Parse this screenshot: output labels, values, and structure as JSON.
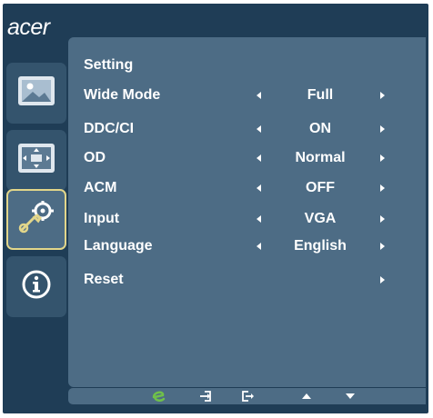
{
  "brand": {
    "logo_text": "acer"
  },
  "sidebar": {
    "items": [
      {
        "name": "picture",
        "icon": "picture-icon",
        "active": false
      },
      {
        "name": "osd-position",
        "icon": "osd-position-icon",
        "active": false
      },
      {
        "name": "setting",
        "icon": "wrench-gear-icon",
        "active": true
      },
      {
        "name": "information",
        "icon": "info-icon",
        "active": false
      }
    ]
  },
  "menu": {
    "title": "Setting",
    "rows": [
      {
        "label": "Wide Mode",
        "value": "Full",
        "arrows": true
      },
      {
        "label": "DDC/CI",
        "value": "ON",
        "arrows": true
      },
      {
        "label": "OD",
        "value": "Normal",
        "arrows": true
      },
      {
        "label": "ACM",
        "value": "OFF",
        "arrows": true
      },
      {
        "label": "Input",
        "value": "VGA",
        "arrows": true
      },
      {
        "label": "Language",
        "value": "English",
        "arrows": true
      },
      {
        "label": "Reset",
        "value": "",
        "arrows": "right-only"
      }
    ]
  },
  "bottom_bar": {
    "items": [
      {
        "icon": "empowering-e-icon"
      },
      {
        "icon": "enter-icon"
      },
      {
        "icon": "exit-icon"
      },
      {
        "icon": "up-arrow-icon"
      },
      {
        "icon": "down-arrow-icon"
      }
    ]
  },
  "colors": {
    "osd_background": "#1f3d56",
    "panel": "#4d6c85",
    "sidebar_button": "#34546d",
    "active_border": "#e2d68a",
    "empowering_icon": "#6fc04a",
    "text": "#ffffff"
  }
}
